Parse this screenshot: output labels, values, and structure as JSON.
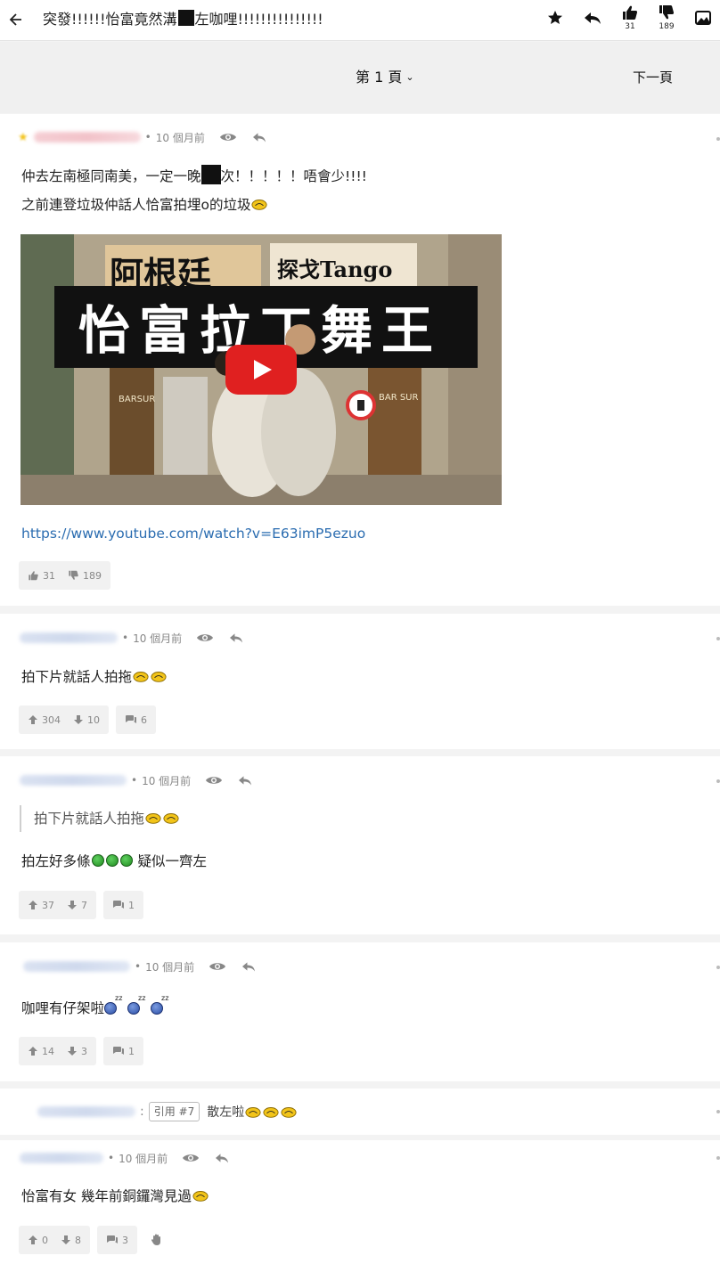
{
  "topbar": {
    "title_before": "突發!!!!!!怡富竟然溝",
    "title_after": "左咖哩!!!!!!!!!!!!!!!",
    "like_count": "31",
    "dislike_count": "189"
  },
  "pagenav": {
    "page_label": "第 1 頁",
    "next_label": "下一頁"
  },
  "posts": [
    {
      "time": "10 個月前",
      "line1_before": "仲去左南極同南美，一定一晚",
      "line1_after": "次！！！！！唔會少!!!!",
      "line2": "之前連登垃圾仲話人恰富拍埋o的垃圾",
      "link": "https://www.youtube.com/watch?v=E63imP5ezuo",
      "video": {
        "title_big": "怡富拉丁舞王",
        "tag_left": "阿根廷",
        "tag_right": "探戈Tango",
        "sign_left": "BARSUR",
        "sign_right": "BAR SUR"
      },
      "up": "31",
      "down": "189"
    },
    {
      "time": "10 個月前",
      "text": "拍下片就話人拍拖",
      "up": "304",
      "down": "10",
      "replies": "6"
    },
    {
      "time": "10 個月前",
      "quote": "拍下片就話人拍拖",
      "text": "拍左好多條",
      "text_after": " 疑似一齊左",
      "up": "37",
      "down": "7",
      "replies": "1"
    },
    {
      "time": "10 個月前",
      "text": "咖哩有仔架啦",
      "up": "14",
      "down": "3",
      "replies": "1"
    },
    {
      "ref": "引用 #7",
      "text": "散左啦"
    },
    {
      "time": "10 個月前",
      "text": "怡富有女 幾年前銅鑼灣見過",
      "up": "0",
      "down": "8",
      "replies": "3"
    }
  ]
}
